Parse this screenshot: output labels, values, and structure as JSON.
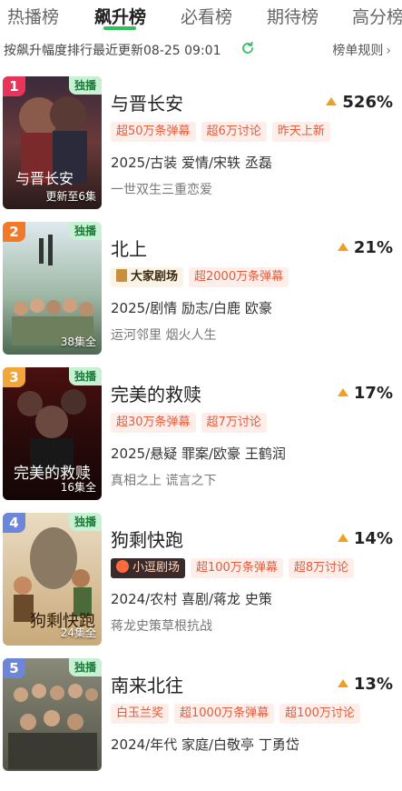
{
  "tabs": [
    {
      "label": "热播榜",
      "active": false
    },
    {
      "label": "飙升榜",
      "active": true
    },
    {
      "label": "必看榜",
      "active": false
    },
    {
      "label": "期待榜",
      "active": false
    },
    {
      "label": "高分榜",
      "active": false
    }
  ],
  "subheader": {
    "description": "按飙升幅度排行最近更新08-25 09:01",
    "rules_label": "榜单规则",
    "refresh_icon": "refresh-icon"
  },
  "colors": {
    "accent_green": "#2ec25b",
    "rank_colors": [
      "#e8335a",
      "#f07a2a",
      "#f2a53a",
      "#6e86d8",
      "#6e86d8"
    ],
    "tag_text": "#e25c3d",
    "rise_arrow": "#f0a020"
  },
  "items": [
    {
      "rank": "1",
      "badge": "独播",
      "title": "与晋长安",
      "rise": "526%",
      "tags": [
        "超50万条弹幕",
        "超6万讨论",
        "昨天上新"
      ],
      "meta": "2025/古装 爱情/宋轶 丞磊",
      "desc": "一世双生三重恋爱",
      "episodes": "更新至6集",
      "brand": null
    },
    {
      "rank": "2",
      "badge": "独播",
      "title": "北上",
      "rise": "21%",
      "tags": [
        "超2000万条弹幕"
      ],
      "meta": "2025/剧情 励志/白鹿 欧豪",
      "desc": "运河邻里 烟火人生",
      "episodes": "38集全",
      "brand": "大家剧场"
    },
    {
      "rank": "3",
      "badge": "独播",
      "title": "完美的救赎",
      "rise": "17%",
      "tags": [
        "超30万条弹幕",
        "超7万讨论"
      ],
      "meta": "2025/悬疑 罪案/欧豪 王鹤润",
      "desc": "真相之上 谎言之下",
      "episodes": "16集全",
      "brand": null
    },
    {
      "rank": "4",
      "badge": "独播",
      "title": "狗剩快跑",
      "rise": "14%",
      "tags": [
        "超100万条弹幕",
        "超8万讨论"
      ],
      "meta": "2024/农村 喜剧/蒋龙 史策",
      "desc": "蒋龙史策草根抗战",
      "episodes": "24集全",
      "brand": "小逗剧场"
    },
    {
      "rank": "5",
      "badge": "独播",
      "title": "南来北往",
      "rise": "13%",
      "tags": [
        "白玉兰奖",
        "超1000万条弹幕",
        "超100万讨论"
      ],
      "meta": "2024/年代 家庭/白敬亭 丁勇岱",
      "desc": "",
      "episodes": "",
      "brand": null
    }
  ]
}
